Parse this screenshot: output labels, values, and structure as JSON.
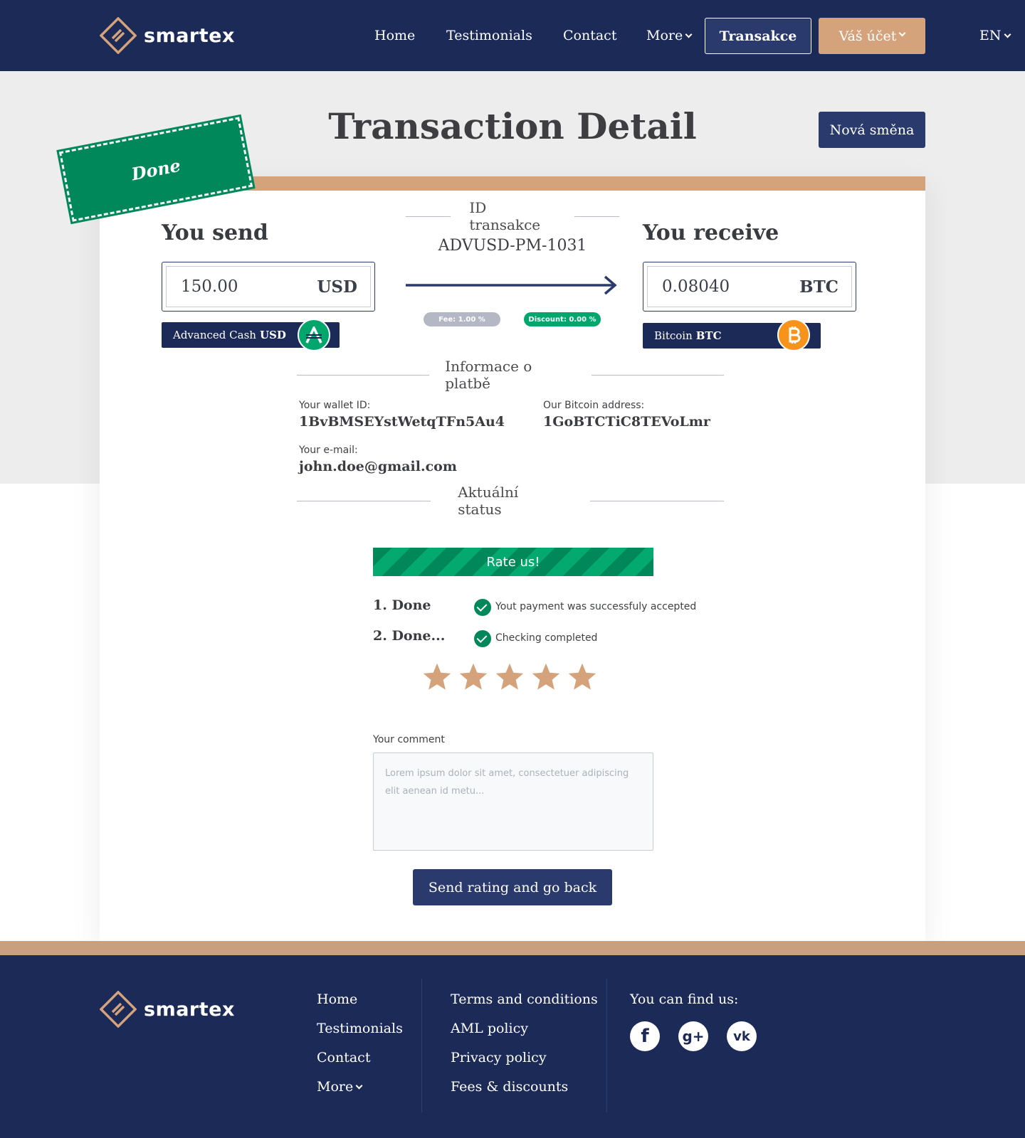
{
  "brand": {
    "name": "smartex"
  },
  "header": {
    "nav": [
      {
        "label": "Home"
      },
      {
        "label": "Testimonials"
      },
      {
        "label": "Contact"
      },
      {
        "label": "More"
      }
    ],
    "transactions_button": "Transakce",
    "account_button": "Váš účet",
    "language": "EN"
  },
  "page": {
    "title": "Transaction Detail",
    "new_exchange_button": "Nová směna",
    "status_stamp": "Done"
  },
  "transaction": {
    "id_label": "ID transakce",
    "id": "ADVUSD-PM-1031",
    "send": {
      "heading": "You send",
      "amount": "150.00",
      "currency": "USD",
      "method_name": "Advanced Cash",
      "method_currency": "USD",
      "icon": "advcash-icon",
      "color": "#00a66c"
    },
    "receive": {
      "heading": "You receive",
      "amount": "0.08040",
      "currency": "BTC",
      "method_name": "Bitcoin",
      "method_currency": "BTC",
      "icon": "bitcoin-icon",
      "color": "#f7931a"
    },
    "fee": "Fee: 1.00 %",
    "discount": "Discount: 0.00 %"
  },
  "payment_info": {
    "title": "Informace o platbě",
    "wallet_label": "Your wallet ID:",
    "wallet_value": "1BvBMSEYstWetqTFn5Au4",
    "address_label": "Our Bitcoin address:",
    "address_value": "1GoBTCTiC8TEVoLmr",
    "email_label": "Your e-mail:",
    "email_value": "john.doe@gmail.com"
  },
  "status": {
    "title": "Aktuální status",
    "rate_button": "Rate us!",
    "steps": [
      {
        "name": "1. Done",
        "text": "Yout payment was successfuly accepted"
      },
      {
        "name": "2. Done...",
        "text": "Checking completed"
      }
    ],
    "rating": 5,
    "rating_max": 5
  },
  "comment": {
    "label": "Your comment",
    "placeholder": "Lorem ipsum dolor sit amet, consectetuer adipiscing elit aenean id metu..."
  },
  "send_button": "Send rating and go back",
  "footer": {
    "col1": [
      {
        "label": "Home"
      },
      {
        "label": "Testimonials"
      },
      {
        "label": "Contact"
      },
      {
        "label": "More"
      }
    ],
    "col2": [
      {
        "label": "Terms and conditions"
      },
      {
        "label": "AML policy"
      },
      {
        "label": "Privacy policy"
      },
      {
        "label": "Fees & discounts"
      }
    ],
    "social_title": "You can find us:",
    "social": [
      {
        "icon": "facebook-icon",
        "glyph": "f"
      },
      {
        "icon": "google-plus-icon",
        "glyph": "g+"
      },
      {
        "icon": "vk-icon",
        "glyph": "vk"
      }
    ]
  },
  "colors": {
    "navy": "#1c2a57",
    "button_navy": "#2a3a6c",
    "tan": "#d4a27b",
    "green": "#00875a"
  }
}
